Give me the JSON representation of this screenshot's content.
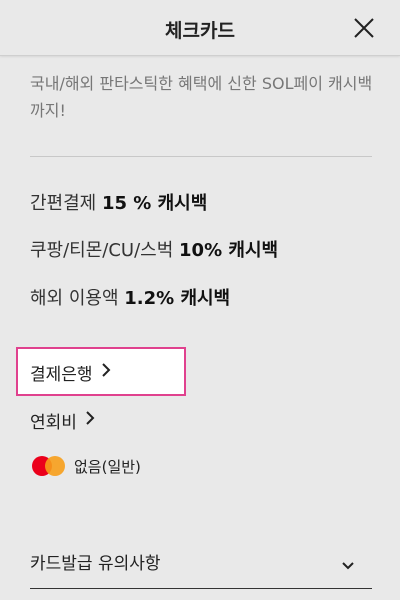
{
  "header": {
    "title": "체크카드"
  },
  "description": "국내/해외 판타스틱한 혜택에 신한 SOL페이 캐시백까지!",
  "benefits": [
    {
      "text": "간편결제 ",
      "highlight": "15 % 캐시백"
    },
    {
      "text": "쿠팡/티몬/CU/스벅 ",
      "highlight": "10% 캐시백"
    },
    {
      "text": "해외 이용액 ",
      "highlight": "1.2% 캐시백"
    }
  ],
  "links": {
    "bank": "결제은행",
    "annual_fee": "연회비"
  },
  "fee": {
    "brand_icon": "mastercard-icon",
    "label": "없음(일반)"
  },
  "notice": {
    "label": "카드발급 유의사항"
  },
  "colors": {
    "highlight_border": "#e0418e",
    "mc_red": "#eb001b",
    "mc_orange": "#f79e1b"
  }
}
